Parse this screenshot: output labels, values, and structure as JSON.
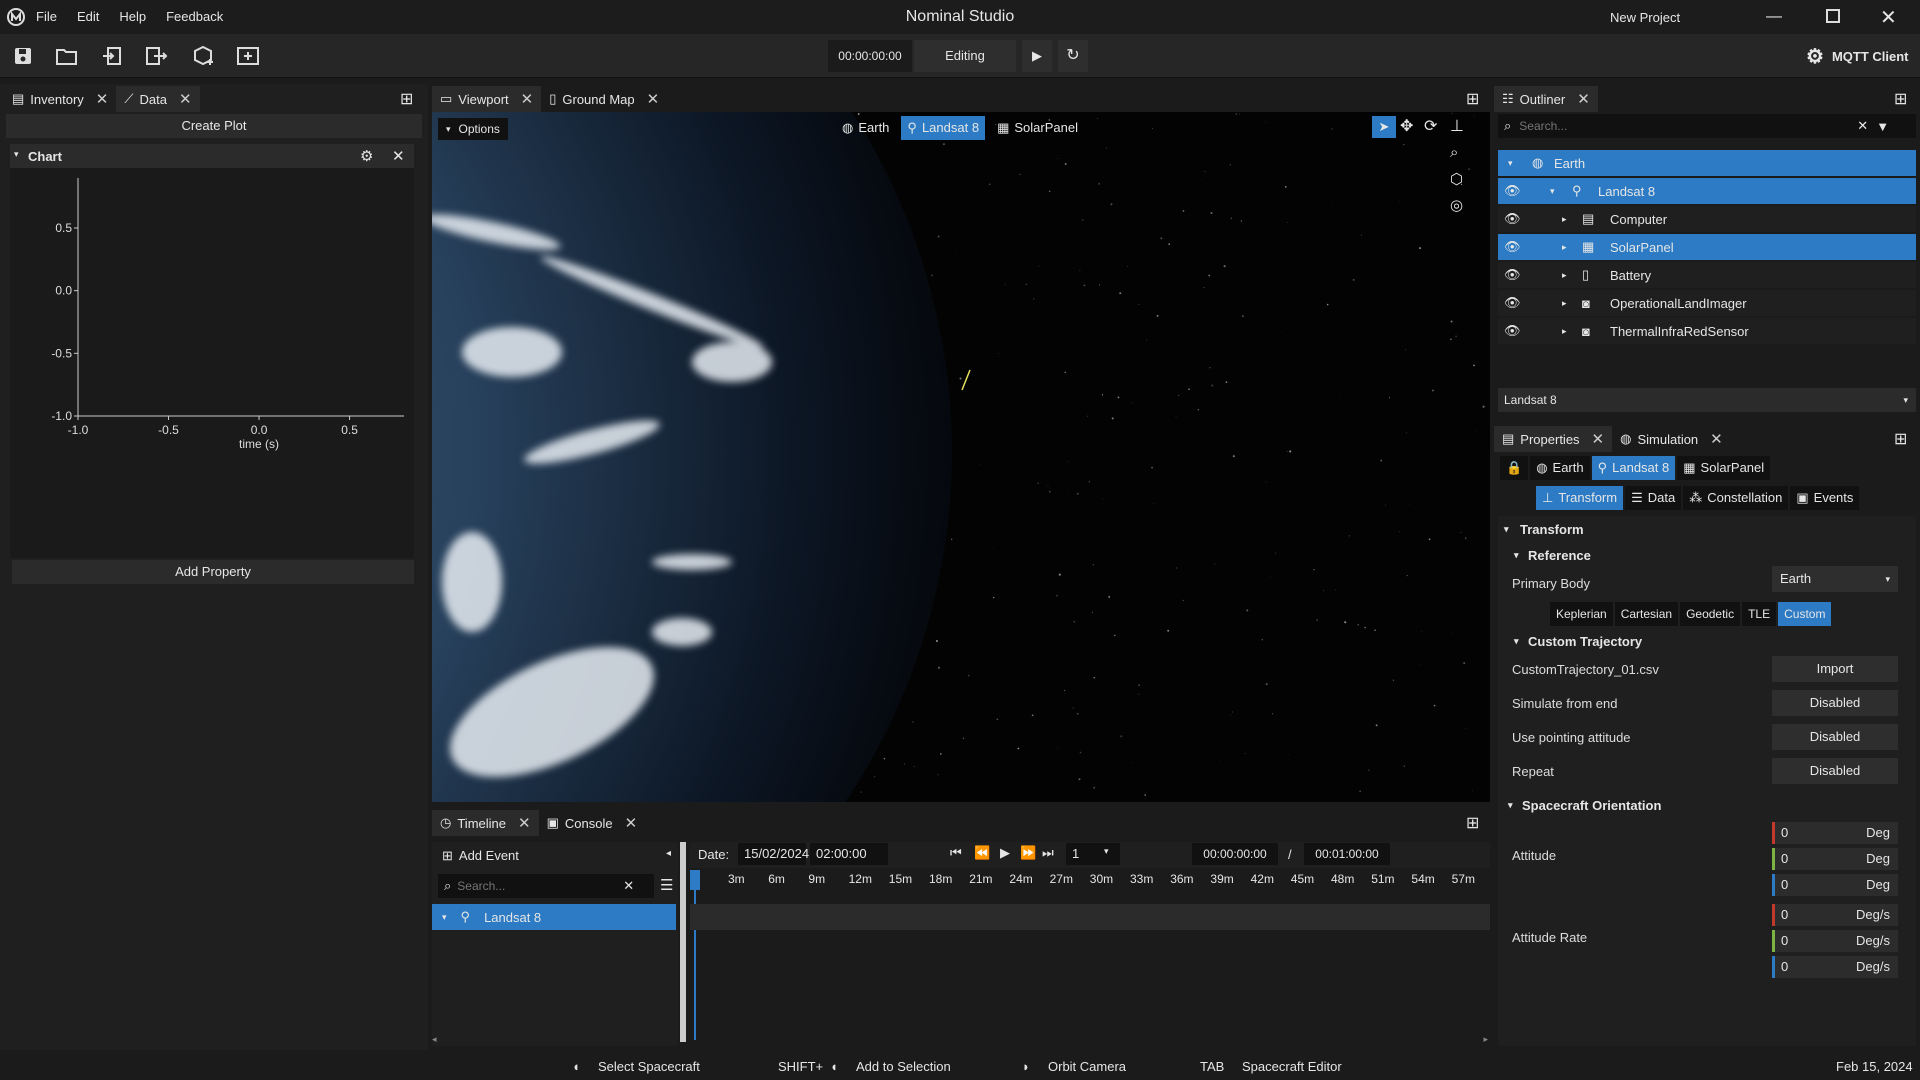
{
  "app": {
    "title": "Nominal Studio",
    "project": "New Project",
    "menu": [
      "File",
      "Edit",
      "Help",
      "Feedback"
    ]
  },
  "toolbar": {
    "time": "00:00:00:00",
    "mode": "Editing",
    "mqtt": "MQTT Client"
  },
  "left": {
    "tabs": [
      "Inventory",
      "Data"
    ],
    "create_plot": "Create Plot",
    "chart_title": "Chart",
    "add_property": "Add Property"
  },
  "chart_data": {
    "type": "line",
    "title": "",
    "xlabel": "time (s)",
    "ylabel": "",
    "xlim": [
      -1.0,
      0.5
    ],
    "ylim": [
      -1.0,
      0.5
    ],
    "xticks": [
      "-1.0",
      "-0.5",
      "0.0",
      "0.5"
    ],
    "yticks": [
      "0.5",
      "0.0",
      "-0.5",
      "-1.0"
    ],
    "series": []
  },
  "viewport": {
    "tabs": [
      "Viewport",
      "Ground Map"
    ],
    "options": "Options",
    "chips": [
      "Earth",
      "Landsat 8",
      "SolarPanel"
    ]
  },
  "outliner": {
    "tab": "Outliner",
    "search_placeholder": "Search...",
    "items": [
      {
        "label": "Earth",
        "icon": "globe-icon"
      },
      {
        "label": "Landsat 8",
        "icon": "satellite-icon"
      },
      {
        "label": "Computer",
        "icon": "chip-icon"
      },
      {
        "label": "SolarPanel",
        "icon": "solar-panel-icon"
      },
      {
        "label": "Battery",
        "icon": "battery-icon"
      },
      {
        "label": "OperationalLandImager",
        "icon": "camera-icon"
      },
      {
        "label": "ThermalInfraRedSensor",
        "icon": "camera-icon"
      }
    ],
    "selected_object": "Landsat 8"
  },
  "props": {
    "tabs": [
      "Properties",
      "Simulation"
    ],
    "chips": [
      "Earth",
      "Landsat 8",
      "SolarPanel"
    ],
    "subtabs": [
      "Transform",
      "Data",
      "Constellation",
      "Events"
    ],
    "transform": "Transform",
    "reference": "Reference",
    "primary_body_label": "Primary Body",
    "primary_body": "Earth",
    "modes": [
      "Keplerian",
      "Cartesian",
      "Geodetic",
      "TLE",
      "Custom"
    ],
    "custom_traj": "Custom Trajectory",
    "file": "CustomTrajectory_01.csv",
    "import": "Import",
    "simulate_from_end": "Simulate from end",
    "use_pointing": "Use pointing attitude",
    "repeat": "Repeat",
    "disabled": "Disabled",
    "orientation": "Spacecraft Orientation",
    "attitude": "Attitude",
    "attitude_rate": "Attitude Rate",
    "attitude_vals": [
      "0",
      "0",
      "0"
    ],
    "deg": "Deg",
    "rate_vals": [
      "0",
      "0",
      "0"
    ],
    "degs": "Deg/s",
    "colors": [
      "#c0392b",
      "#7cb342",
      "#2c7bc4"
    ]
  },
  "timeline": {
    "tabs": [
      "Timeline",
      "Console"
    ],
    "add_event": "Add Event",
    "search_placeholder": "Search...",
    "track": "Landsat 8",
    "date_label": "Date:",
    "date": "15/02/2024",
    "time": "02:00:00",
    "speed": "1",
    "cur": "00:00:00:00",
    "sep": "/",
    "end": "00:01:00:00",
    "ticks": [
      "3m",
      "6m",
      "9m",
      "12m",
      "15m",
      "18m",
      "21m",
      "24m",
      "27m",
      "30m",
      "33m",
      "36m",
      "39m",
      "42m",
      "45m",
      "48m",
      "51m",
      "54m",
      "57m"
    ]
  },
  "status": {
    "items": [
      "Select Spacecraft",
      "SHIFT+",
      "Add to Selection",
      "Orbit Camera",
      "TAB",
      "Spacecraft Editor"
    ],
    "date": "Feb 15, 2024"
  }
}
